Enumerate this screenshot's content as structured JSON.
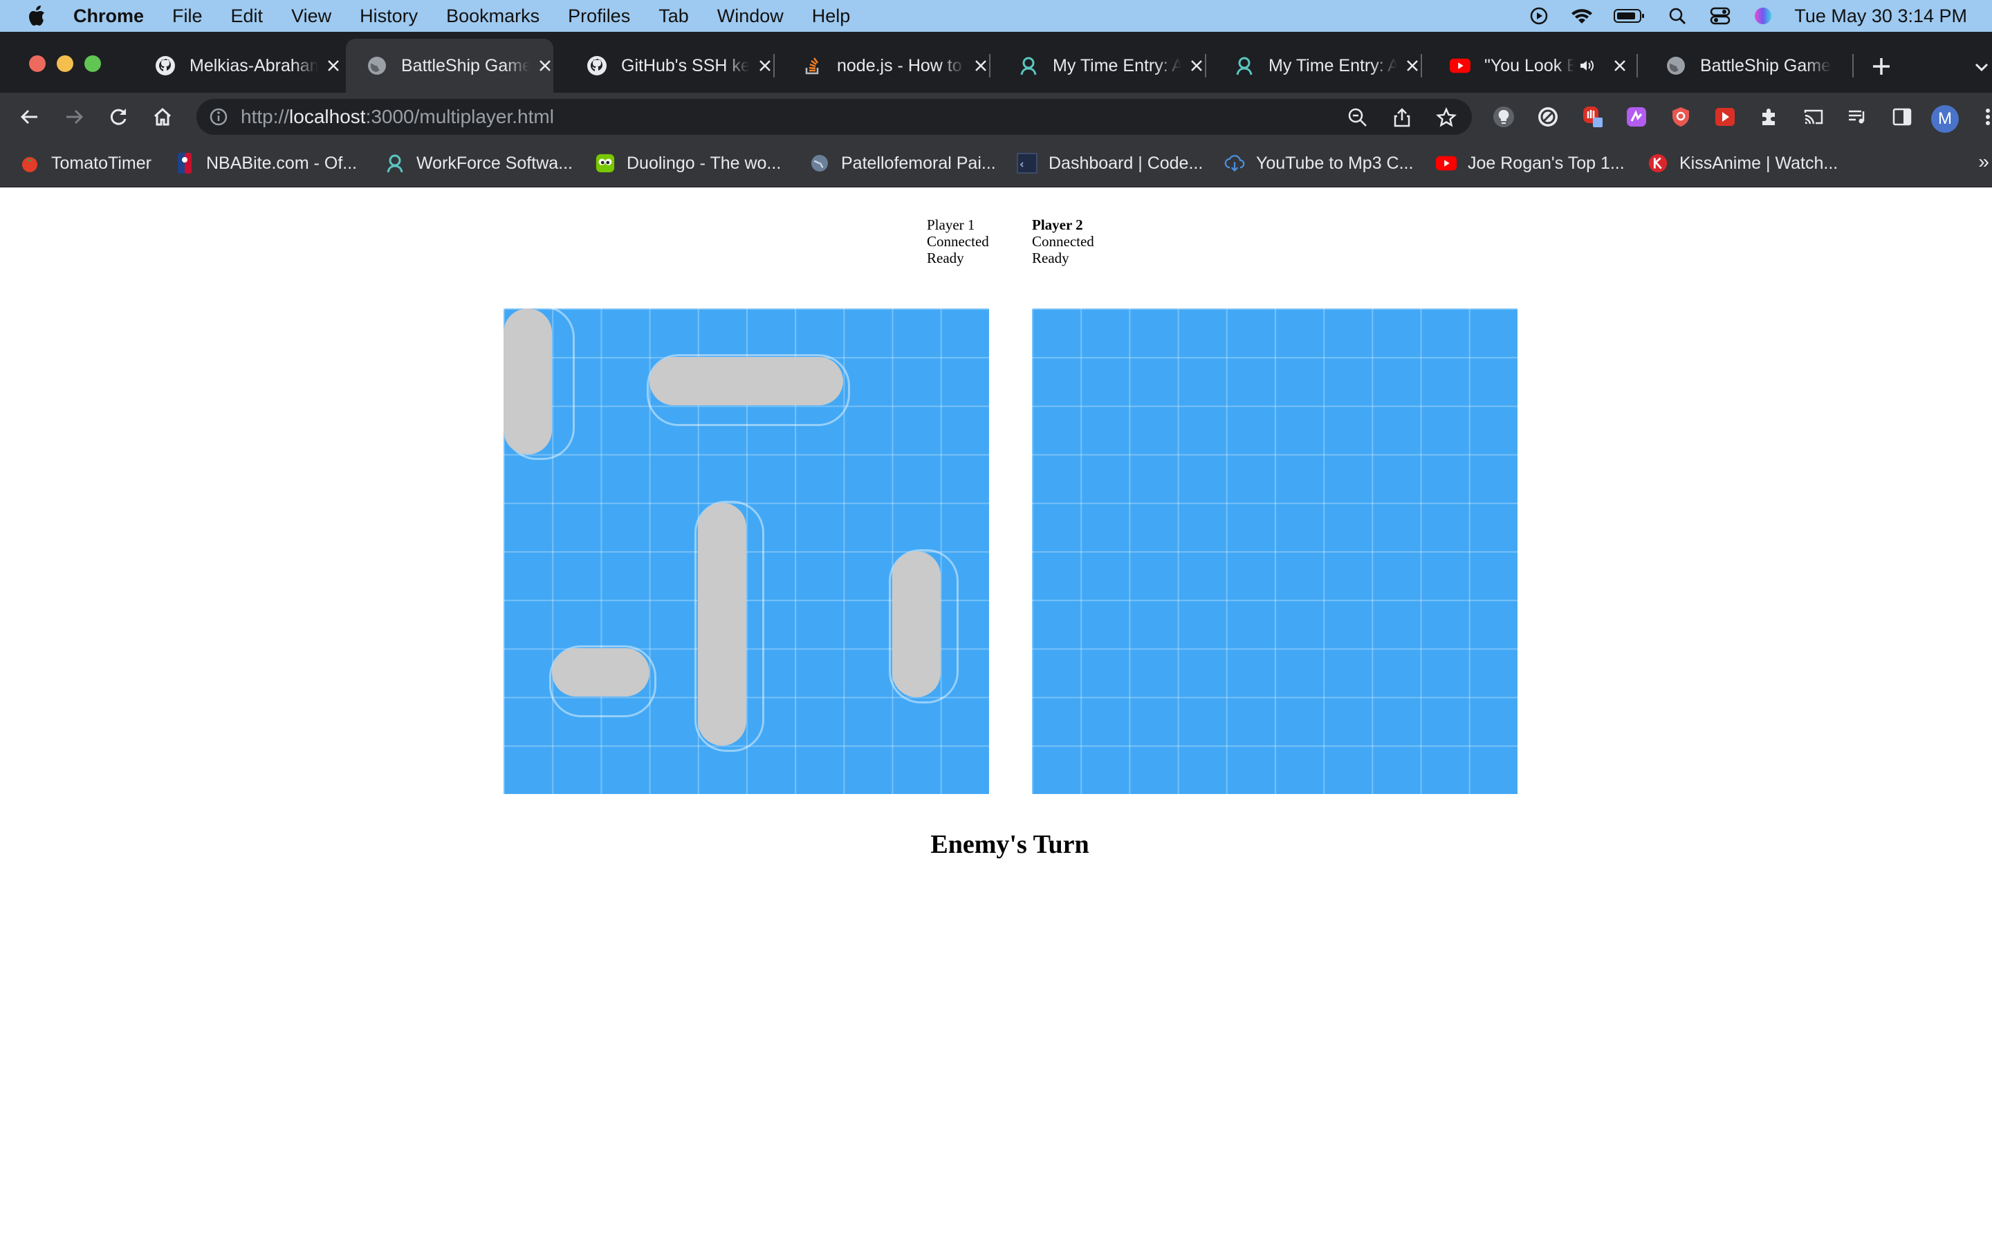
{
  "menubar": {
    "app_name": "Chrome",
    "items": [
      "File",
      "Edit",
      "View",
      "History",
      "Bookmarks",
      "Profiles",
      "Tab",
      "Window",
      "Help"
    ],
    "clock": "Tue May 30  3:14 PM"
  },
  "tabs": [
    {
      "title": "Melkias-Abraham",
      "icon": "github-icon",
      "active": false
    },
    {
      "title": "BattleShip Game",
      "icon": "globe-icon",
      "active": true
    },
    {
      "title": "GitHub's SSH key",
      "icon": "github-icon",
      "active": false
    },
    {
      "title": "node.js - How to",
      "icon": "stackoverflow-icon",
      "active": false
    },
    {
      "title": "My Time Entry: A",
      "icon": "workforce-icon",
      "active": false
    },
    {
      "title": "My Time Entry: A",
      "icon": "workforce-icon",
      "active": false
    },
    {
      "title": "\"You Look E",
      "icon": "youtube-icon",
      "active": false,
      "audio": true
    },
    {
      "title": "BattleShip Game",
      "icon": "globe-icon",
      "active": false
    }
  ],
  "toolbar": {
    "url_scheme": "http://",
    "url_host": "localhost",
    "url_rest": ":3000/multiplayer.html",
    "profile_initial": "M"
  },
  "bookmarks": [
    {
      "label": "TomatoTimer",
      "icon": "tomato-icon"
    },
    {
      "label": "NBABite.com - Of...",
      "icon": "nba-icon"
    },
    {
      "label": "WorkForce Softwa...",
      "icon": "workforce-icon"
    },
    {
      "label": "Duolingo - The wo...",
      "icon": "duolingo-icon"
    },
    {
      "label": "Patellofemoral Pai...",
      "icon": "globe-icon"
    },
    {
      "label": "Dashboard | Code...",
      "icon": "codeacademy-icon"
    },
    {
      "label": "YouTube to Mp3 C...",
      "icon": "download-cloud-icon"
    },
    {
      "label": "Joe Rogan's Top 1...",
      "icon": "youtube-icon"
    },
    {
      "label": "KissAnime | Watch...",
      "icon": "kissanime-icon"
    }
  ],
  "game": {
    "players": [
      {
        "name": "Player 1",
        "connection": "Connected",
        "state": "Ready",
        "is_current": false
      },
      {
        "name": "Player 2",
        "connection": "Connected",
        "state": "Ready",
        "is_current": true
      }
    ],
    "turn_text": "Enemy's Turn",
    "grid_size": 10,
    "ships": [
      {
        "name": "destroyer",
        "orientation": "vertical",
        "row": 0,
        "col": 0,
        "length": 3
      },
      {
        "name": "submarine",
        "orientation": "horizontal",
        "row": 1,
        "col": 3,
        "length": 4
      },
      {
        "name": "battleship",
        "orientation": "vertical",
        "row": 4,
        "col": 4,
        "length": 5
      },
      {
        "name": "cruiser",
        "orientation": "vertical",
        "row": 5,
        "col": 8,
        "length": 3
      },
      {
        "name": "patrol-boat",
        "orientation": "horizontal",
        "row": 7,
        "col": 1,
        "length": 2
      }
    ],
    "colors": {
      "water": "#42a8f5",
      "ship": "#cacaca"
    }
  }
}
